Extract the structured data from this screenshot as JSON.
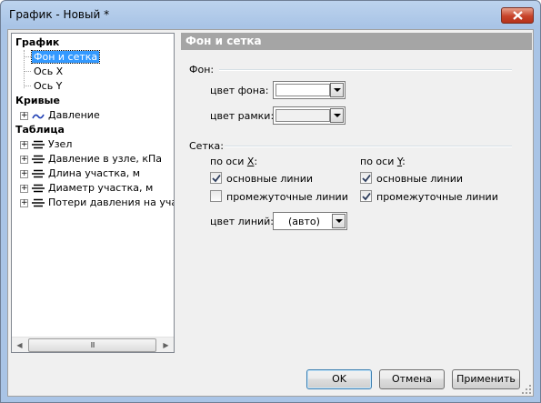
{
  "window": {
    "title": "График - Новый *"
  },
  "tree": {
    "sections": [
      {
        "label": "График"
      },
      {
        "label": "Кривые"
      },
      {
        "label": "Таблица"
      }
    ],
    "graph_items": [
      "Фон и сетка",
      "Ось X",
      "Ось Y"
    ],
    "curve_items": [
      "Давление"
    ],
    "table_items": [
      "Узел",
      "Давление в узле, кПа",
      "Длина участка, м",
      "Диаметр участка, м",
      "Потери давления на участк"
    ],
    "scrollbar_grip": "III"
  },
  "panel": {
    "header": "Фон и сетка",
    "background_group": "Фон:",
    "bg_color_label": "цвет фона:",
    "bg_color_value": "#ffffff",
    "frame_color_label": "цвет рамки:",
    "frame_color_value": "#f0f0f0",
    "grid_group": "Сетка:",
    "axis_x": {
      "prefix": "по оси ",
      "letter": "X",
      "suffix": ":"
    },
    "axis_y": {
      "prefix": "по оси ",
      "letter": "Y",
      "suffix": ":"
    },
    "x_major": {
      "label": "основные линии",
      "checked": true
    },
    "x_minor": {
      "label": "промежуточные линии",
      "checked": false
    },
    "y_major": {
      "label": "основные линии",
      "checked": true
    },
    "y_minor": {
      "label": "промежуточные линии",
      "checked": true
    },
    "line_color_label": "цвет линий:",
    "line_color_value": "(авто)"
  },
  "buttons": {
    "ok": "OK",
    "cancel": "Отмена",
    "apply": "Применить"
  },
  "colors": {
    "selection": "#3399ff",
    "header_bg": "#a5a5a5",
    "close_red": "#c7432a"
  }
}
